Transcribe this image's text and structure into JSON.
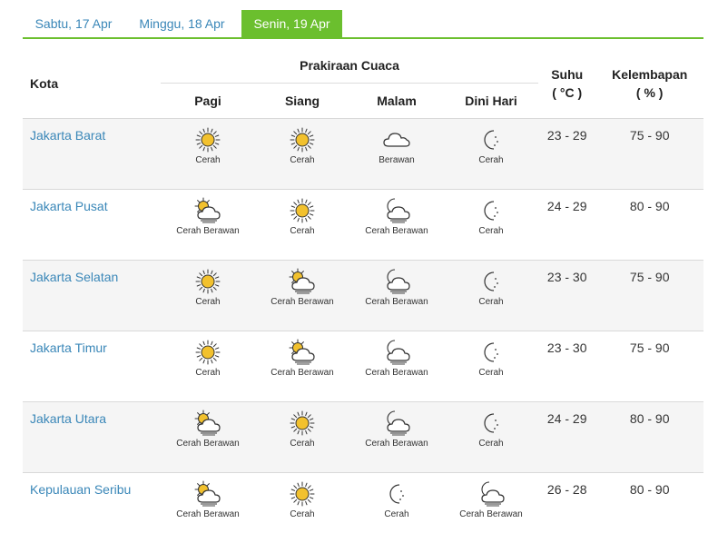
{
  "tabs": [
    {
      "label": "Sabtu, 17 Apr"
    },
    {
      "label": "Minggu, 18 Apr"
    },
    {
      "label": "Senin, 19 Apr"
    }
  ],
  "header": {
    "kota": "Kota",
    "prakiraan": "Prakiraan Cuaca",
    "suhu": "Suhu",
    "suhu_unit": "( °C )",
    "kelembapan": "Kelembapan",
    "kelembapan_unit": "( % )",
    "periods": [
      "Pagi",
      "Siang",
      "Malam",
      "Dini Hari"
    ]
  },
  "rows": [
    {
      "city": "Jakarta Barat",
      "wx": [
        {
          "icon": "sun-icon",
          "label": "Cerah"
        },
        {
          "icon": "sun-icon",
          "label": "Cerah"
        },
        {
          "icon": "cloud-icon",
          "label": "Berawan"
        },
        {
          "icon": "moon-icon",
          "label": "Cerah"
        }
      ],
      "suhu": "23 - 29",
      "kelembapan": "75 - 90"
    },
    {
      "city": "Jakarta Pusat",
      "wx": [
        {
          "icon": "sun-cloud-icon",
          "label": "Cerah Berawan"
        },
        {
          "icon": "sun-icon",
          "label": "Cerah"
        },
        {
          "icon": "moon-cloud-icon",
          "label": "Cerah Berawan"
        },
        {
          "icon": "moon-icon",
          "label": "Cerah"
        }
      ],
      "suhu": "24 - 29",
      "kelembapan": "80 - 90"
    },
    {
      "city": "Jakarta Selatan",
      "wx": [
        {
          "icon": "sun-icon",
          "label": "Cerah"
        },
        {
          "icon": "sun-cloud-icon",
          "label": "Cerah Berawan"
        },
        {
          "icon": "moon-cloud-icon",
          "label": "Cerah Berawan"
        },
        {
          "icon": "moon-icon",
          "label": "Cerah"
        }
      ],
      "suhu": "23 - 30",
      "kelembapan": "75 - 90"
    },
    {
      "city": "Jakarta Timur",
      "wx": [
        {
          "icon": "sun-icon",
          "label": "Cerah"
        },
        {
          "icon": "sun-cloud-icon",
          "label": "Cerah Berawan"
        },
        {
          "icon": "moon-cloud-icon",
          "label": "Cerah Berawan"
        },
        {
          "icon": "moon-icon",
          "label": "Cerah"
        }
      ],
      "suhu": "23 - 30",
      "kelembapan": "75 - 90"
    },
    {
      "city": "Jakarta Utara",
      "wx": [
        {
          "icon": "sun-cloud-icon",
          "label": "Cerah Berawan"
        },
        {
          "icon": "sun-icon",
          "label": "Cerah"
        },
        {
          "icon": "moon-cloud-icon",
          "label": "Cerah Berawan"
        },
        {
          "icon": "moon-icon",
          "label": "Cerah"
        }
      ],
      "suhu": "24 - 29",
      "kelembapan": "80 - 90"
    },
    {
      "city": "Kepulauan Seribu",
      "wx": [
        {
          "icon": "sun-cloud-icon",
          "label": "Cerah Berawan"
        },
        {
          "icon": "sun-icon",
          "label": "Cerah"
        },
        {
          "icon": "moon-icon",
          "label": "Cerah"
        },
        {
          "icon": "moon-cloud-icon",
          "label": "Cerah Berawan"
        }
      ],
      "suhu": "26 - 28",
      "kelembapan": "80 - 90"
    }
  ],
  "colors": {
    "accent": "#6bbf2e",
    "link": "#3a87b8",
    "sun": "#f2c12e"
  }
}
